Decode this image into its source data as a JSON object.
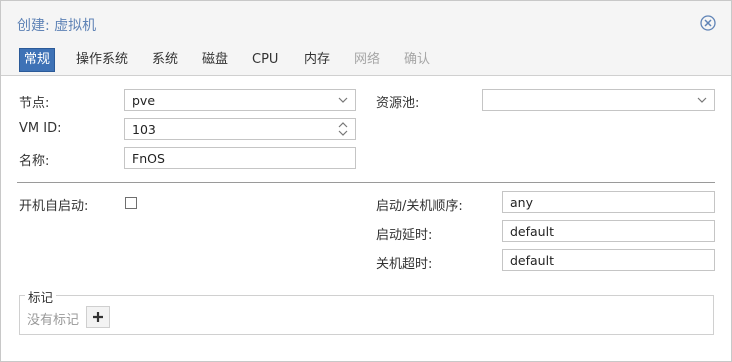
{
  "dialog": {
    "title": "创建: 虚拟机",
    "close_icon": "close-circle-icon"
  },
  "tabs": [
    {
      "label": "常规",
      "state": "active"
    },
    {
      "label": "操作系统",
      "state": "normal"
    },
    {
      "label": "系统",
      "state": "normal"
    },
    {
      "label": "磁盘",
      "state": "normal"
    },
    {
      "label": "CPU",
      "state": "normal"
    },
    {
      "label": "内存",
      "state": "normal"
    },
    {
      "label": "网络",
      "state": "disabled"
    },
    {
      "label": "确认",
      "state": "disabled"
    }
  ],
  "form": {
    "node": {
      "label": "节点:",
      "value": "pve"
    },
    "vmid": {
      "label": "VM ID:",
      "value": "103"
    },
    "name": {
      "label": "名称:",
      "value": "FnOS"
    },
    "pool": {
      "label": "资源池:",
      "value": ""
    },
    "onboot": {
      "label": "开机自启动:",
      "checked": false
    },
    "startup_order": {
      "label": "启动/关机顺序:",
      "value": "any"
    },
    "startup_delay": {
      "label": "启动延时:",
      "value": "default"
    },
    "shutdown_timeout": {
      "label": "关机超时:",
      "value": "default"
    }
  },
  "tags": {
    "legend": "标记",
    "empty_text": "没有标记",
    "add_icon": "plus-icon"
  }
}
